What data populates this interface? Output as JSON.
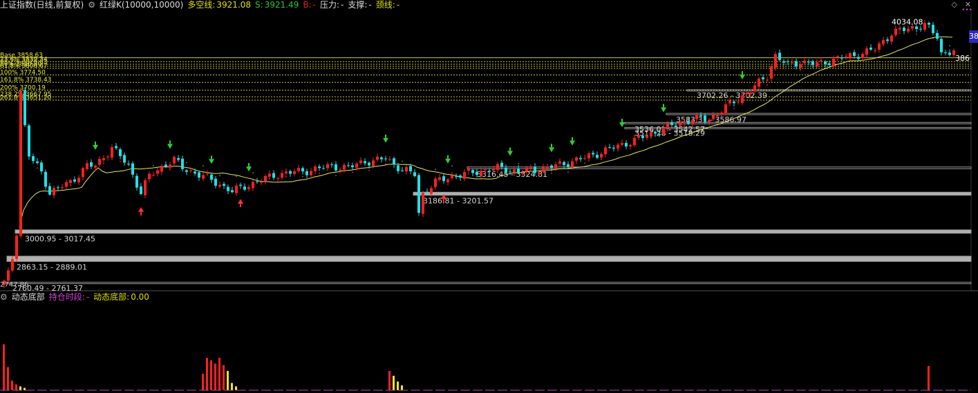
{
  "header": {
    "indicator_title": "上证指数(日线,前复权)",
    "gear_icon": "gear-icon",
    "hongluk": "红绿K(10000,10000)",
    "duokong_label": "多空线:",
    "duokong_value": "3921.08",
    "s_label": "S:",
    "s_value": "3921.49",
    "b_label": "B:",
    "b_value": "-",
    "pressure_label": "压力:",
    "pressure_value": "-",
    "support_label": "支撑:",
    "support_value": "-",
    "neckline_label": "颈线:",
    "neckline_value": "-",
    "colors": {
      "duokong": "#e0e000",
      "s": "#2ec82e",
      "b": "#e02020"
    }
  },
  "right_badge": "38",
  "sub_header": {
    "gear_icon": "gear-icon",
    "name": "动态底部",
    "hold_label": "持仓时段:",
    "hold_value": "-",
    "bottom_label": "动态底部:",
    "bottom_value": "0.00"
  },
  "chart_data": {
    "type": "candlestick",
    "ylim": [
      2730,
      4080
    ],
    "colors": {
      "up": "#ff2020",
      "down": "#20e0e8",
      "ma": "#e8e860",
      "grid": "#888888"
    },
    "annotations": {
      "peak": "4034.08",
      "right_price": "386",
      "low_left": "2747.86"
    },
    "level_boxes": [
      {
        "label": "3000.95 - 3017.45",
        "low": 3000.95,
        "high": 3017.45
      },
      {
        "label": "2863.15 - 2889.01",
        "low": 2863.15,
        "high": 2889.01
      },
      {
        "label": "2760.49 - 2761.37",
        "low": 2760.49,
        "high": 2761.37
      },
      {
        "label": "3186.81 - 3201.57",
        "low": 3186.81,
        "high": 3201.57
      },
      {
        "label": "3316.45 - 3324.81",
        "low": 3316.45,
        "high": 3324.81
      },
      {
        "label": "3517.28 - 3518.29",
        "low": 3517.28,
        "high": 3518.29
      },
      {
        "label": "3536.01 - 3542.57",
        "low": 3536.01,
        "high": 3542.57
      },
      {
        "label": "3583.31 - 3586.97",
        "low": 3583.31,
        "high": 3586.97
      },
      {
        "label": "3702.26 - 3702.39",
        "low": 3702.26,
        "high": 3702.39
      }
    ],
    "fib_labels": [
      "Base 3858.63",
      "23.6% 3839.34",
      "38.2% 3826.83",
      "50% 3816.80",
      "61.8% 3806.67",
      "100% 3774.50",
      "161.8% 3738.43",
      "200% 3700.19",
      "238.2% 3667.95",
      "261.8% 3651.20"
    ],
    "down_arrow_bars": [
      22,
      40,
      50,
      59,
      92,
      107,
      122,
      132,
      137,
      149,
      159,
      178
    ],
    "up_arrow_bars": [
      33,
      57,
      106
    ],
    "volume_bars": [
      {
        "x": 0,
        "v": 0.95,
        "c": "#ff2020"
      },
      {
        "x": 1,
        "v": 0.48,
        "c": "#ff2020"
      },
      {
        "x": 2,
        "v": 0.2,
        "c": "#ff2020"
      },
      {
        "x": 3,
        "v": 0.12,
        "c": "#ff2020"
      },
      {
        "x": 4,
        "v": 0.08,
        "c": "#e8e820"
      },
      {
        "x": 5,
        "v": 0.05,
        "c": "#e8e820"
      },
      {
        "x": 48,
        "v": 0.34,
        "c": "#ff2020"
      },
      {
        "x": 49,
        "v": 0.67,
        "c": "#ff2020"
      },
      {
        "x": 50,
        "v": 0.62,
        "c": "#ff2020"
      },
      {
        "x": 51,
        "v": 0.55,
        "c": "#ff2020"
      },
      {
        "x": 52,
        "v": 0.67,
        "c": "#ff2020"
      },
      {
        "x": 53,
        "v": 0.52,
        "c": "#ff2020"
      },
      {
        "x": 54,
        "v": 0.4,
        "c": "#e8e820"
      },
      {
        "x": 55,
        "v": 0.15,
        "c": "#e8e820"
      },
      {
        "x": 56,
        "v": 0.08,
        "c": "#e8e820"
      },
      {
        "x": 93,
        "v": 0.4,
        "c": "#ff2020"
      },
      {
        "x": 94,
        "v": 0.3,
        "c": "#e8e820"
      },
      {
        "x": 95,
        "v": 0.18,
        "c": "#e8e820"
      },
      {
        "x": 96,
        "v": 0.1,
        "c": "#e8e820"
      },
      {
        "x": 223,
        "v": 0.5,
        "c": "#ff2020"
      }
    ]
  }
}
